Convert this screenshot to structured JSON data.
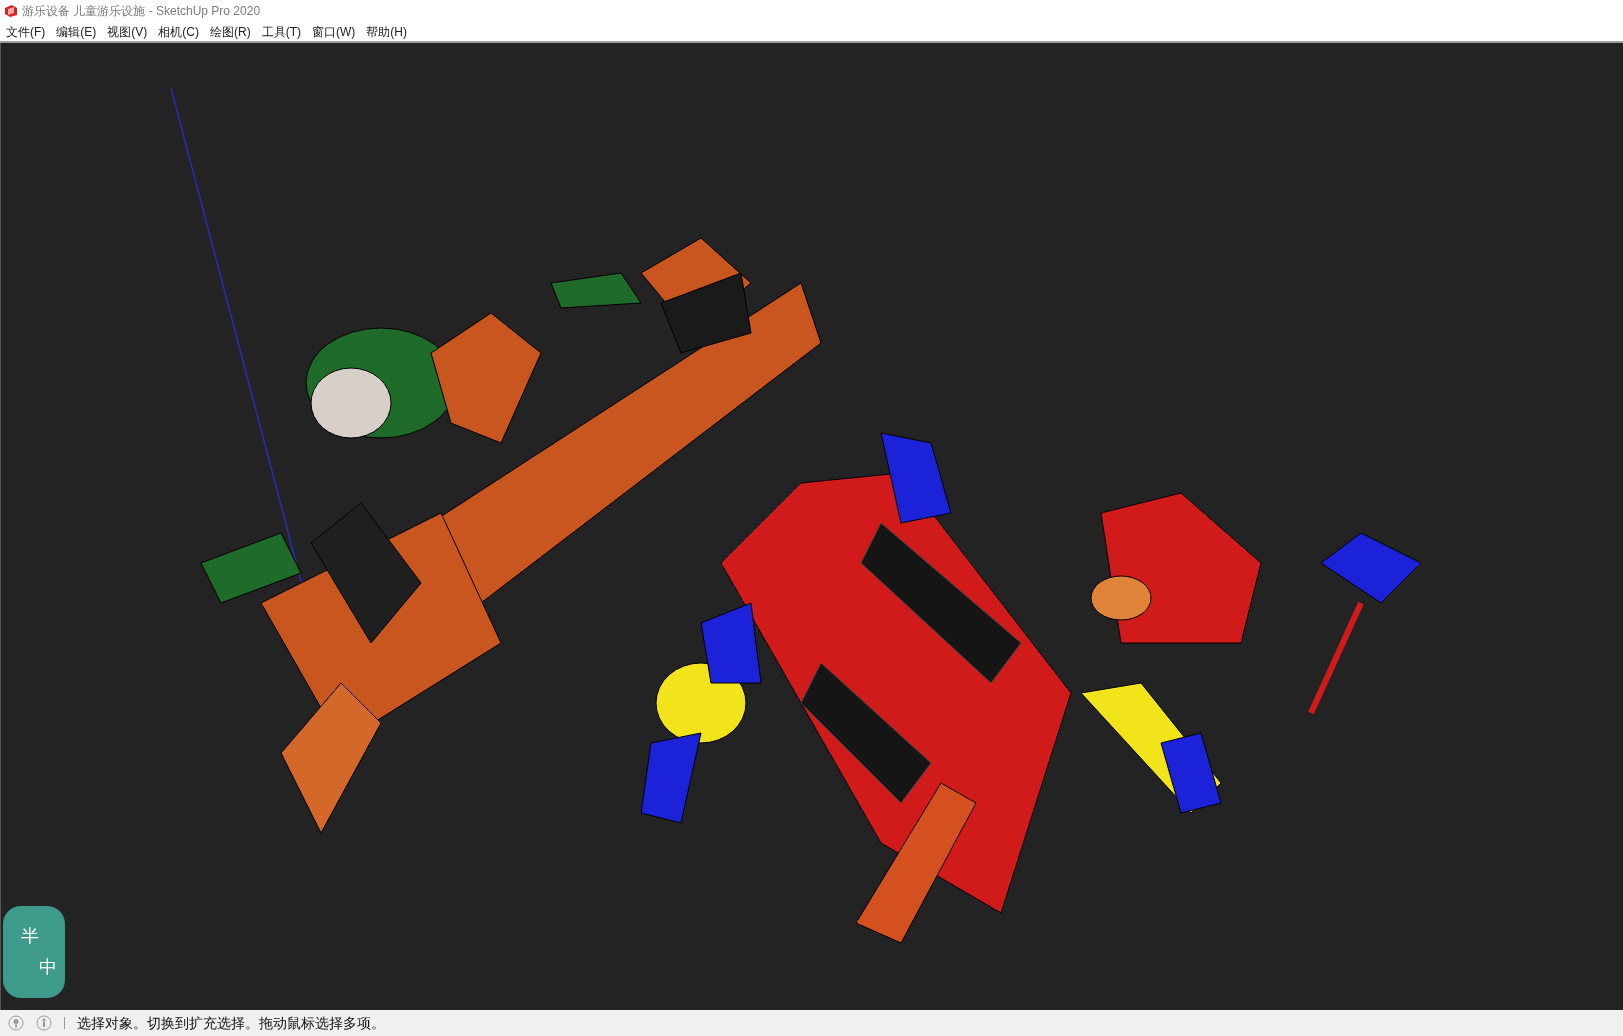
{
  "window": {
    "title": "游乐设备 儿童游乐设施 - SketchUp Pro 2020"
  },
  "menu": [
    "文件(F)",
    "编辑(E)",
    "视图(V)",
    "相机(C)",
    "绘图(R)",
    "工具(T)",
    "窗口(W)",
    "帮助(H)"
  ],
  "ime": {
    "width_mode": "半",
    "language": "中"
  },
  "status_bar": {
    "message": "选择对象。切换到扩充选择。拖动鼠标选择多项。"
  }
}
